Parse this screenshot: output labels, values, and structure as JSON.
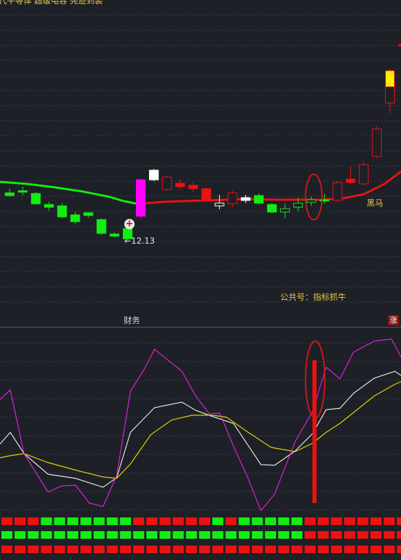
{
  "header": {
    "title": "代牛等体 超级电容 亮迹到装"
  },
  "annotations": {
    "price_low_marker": "←12.13",
    "signal_label": "黑马",
    "public_account": "公共号：指标抓牛",
    "finance_label": "财务",
    "rise_badge": "涨"
  },
  "colors": {
    "background": "#1e2027",
    "grid": "#3a3f48",
    "up": "#ee1111",
    "down": "#11ee11",
    "signal": "#ff00ff",
    "highlight_yellow": "#ffee00",
    "k_line": "#e8e8e8",
    "d_line": "#e8d800",
    "j_line": "#e020e0",
    "ellipse": "#cc1818"
  },
  "icons": {
    "plus_badge": "plus-circle-icon"
  },
  "chart_data": [
    {
      "type": "candlestick",
      "title": "",
      "candles": [
        {
          "o": 285,
          "c": 281,
          "h": 287,
          "l": 275,
          "dir": "dn",
          "col": "#11ee11"
        },
        {
          "o": 278,
          "c": 278,
          "h": 285,
          "l": 272,
          "dir": "dn",
          "col": "#11ee11"
        },
        {
          "o": 282,
          "c": 297,
          "h": 298,
          "l": 280,
          "dir": "dn",
          "col": "#11ee11"
        },
        {
          "o": 298,
          "c": 302,
          "h": 307,
          "l": 294,
          "dir": "dn",
          "col": "#11ee11"
        },
        {
          "o": 300,
          "c": 316,
          "h": 318,
          "l": 296,
          "dir": "dn",
          "col": "#11ee11"
        },
        {
          "o": 313,
          "c": 323,
          "h": 326,
          "l": 309,
          "dir": "dn",
          "col": "#11ee11"
        },
        {
          "o": 310,
          "c": 314,
          "h": 317,
          "l": 309,
          "dir": "dn",
          "col": "#11ee11"
        },
        {
          "o": 320,
          "c": 340,
          "h": 342,
          "l": 318,
          "dir": "dn",
          "col": "#11ee11"
        },
        {
          "o": 341,
          "c": 344,
          "h": 346,
          "l": 339,
          "dir": "dn",
          "col": "#11ee11"
        },
        {
          "o": 333,
          "c": 348,
          "h": 350,
          "l": 328,
          "dir": "dn",
          "col": "#11ee11"
        },
        {
          "o": 315,
          "c": 262,
          "h": 260,
          "l": 318,
          "dir": "up",
          "col": "#ff00ff"
        },
        {
          "o": 262,
          "c": 248,
          "h": 246,
          "l": 264,
          "dir": "up",
          "col": "#ffffff"
        },
        {
          "o": 276,
          "c": 258,
          "h": 256,
          "l": 278,
          "dir": "up",
          "col": "#ee1111",
          "hollow": true
        },
        {
          "o": 272,
          "c": 267,
          "h": 262,
          "l": 276,
          "dir": "up",
          "col": "#ee1111"
        },
        {
          "o": 275,
          "c": 270,
          "h": 266,
          "l": 280,
          "dir": "up",
          "col": "#ee1111"
        },
        {
          "o": 293,
          "c": 275,
          "h": 273,
          "l": 294,
          "dir": "up",
          "col": "#ee1111"
        },
        {
          "o": 296,
          "c": 300,
          "h": 284,
          "l": 305,
          "dir": "dn",
          "col": "#ffffff",
          "hollow": true
        },
        {
          "o": 297,
          "c": 281,
          "h": 278,
          "l": 302,
          "dir": "up",
          "col": "#ee1111",
          "hollow": true
        },
        {
          "o": 288,
          "c": 292,
          "h": 284,
          "l": 296,
          "dir": "dn",
          "col": "#ffffff"
        },
        {
          "o": 285,
          "c": 296,
          "h": 282,
          "l": 298,
          "dir": "dn",
          "col": "#11ee11"
        },
        {
          "o": 298,
          "c": 309,
          "h": 296,
          "l": 311,
          "dir": "dn",
          "col": "#11ee11"
        },
        {
          "o": 304,
          "c": 309,
          "h": 297,
          "l": 318,
          "dir": "dn",
          "col": "#11ee11",
          "hollow": true
        },
        {
          "o": 296,
          "c": 302,
          "h": 288,
          "l": 308,
          "dir": "dn",
          "col": "#11ee11",
          "hollow": true
        },
        {
          "o": 291,
          "c": 295,
          "h": 286,
          "l": 300,
          "dir": "dn",
          "col": "#11ee11",
          "hollow": true
        },
        {
          "o": 291,
          "c": 293,
          "h": 282,
          "l": 297,
          "dir": "dn",
          "col": "#11ee11"
        },
        {
          "o": 292,
          "c": 266,
          "h": 264,
          "l": 295,
          "dir": "up",
          "col": "#ee1111",
          "hollow": true
        },
        {
          "o": 266,
          "c": 261,
          "h": 242,
          "l": 268,
          "dir": "up",
          "col": "#ee1111"
        },
        {
          "o": 268,
          "c": 240,
          "h": 236,
          "l": 270,
          "dir": "up",
          "col": "#ee1111",
          "hollow": true
        },
        {
          "o": 228,
          "c": 188,
          "h": 183,
          "l": 230,
          "dir": "up",
          "col": "#ee1111",
          "hollow": true
        },
        {
          "o": 150,
          "c": 103,
          "h": 100,
          "l": 165,
          "dir": "up",
          "col": "#ee1111",
          "split": true
        },
        {
          "o": 65,
          "c": 65,
          "h": 10,
          "l": 65,
          "dir": "up",
          "col": "#ee1111"
        }
      ],
      "ma_line": [
        [
          0,
          265
        ],
        [
          40,
          268
        ],
        [
          80,
          273
        ],
        [
          120,
          279
        ],
        [
          160,
          287
        ],
        [
          180,
          293
        ],
        [
          200,
          297
        ],
        [
          240,
          294
        ],
        [
          300,
          292
        ],
        [
          360,
          290
        ],
        [
          400,
          291
        ],
        [
          440,
          291
        ],
        [
          470,
          291
        ],
        [
          500,
          289
        ],
        [
          530,
          283
        ],
        [
          560,
          268
        ],
        [
          584,
          250
        ]
      ],
      "ma_split_x": 205
    },
    {
      "type": "line",
      "title": "",
      "series": [
        {
          "name": "",
          "color": "#e8e8e8",
          "points": [
            [
              0,
              647
            ],
            [
              15,
              630
            ],
            [
              35,
              661
            ],
            [
              70,
              691
            ],
            [
              110,
              697
            ],
            [
              150,
              710
            ],
            [
              170,
              696
            ],
            [
              190,
              630
            ],
            [
              225,
              594
            ],
            [
              265,
              586
            ],
            [
              285,
              598
            ],
            [
              310,
              607
            ],
            [
              340,
              617
            ],
            [
              380,
              677
            ],
            [
              400,
              678
            ],
            [
              430,
              657
            ],
            [
              455,
              632
            ],
            [
              475,
              597
            ],
            [
              495,
              595
            ],
            [
              515,
              573
            ],
            [
              545,
              551
            ],
            [
              575,
              541
            ],
            [
              584,
              547
            ]
          ]
        },
        {
          "name": "",
          "color": "#e8d800",
          "points": [
            [
              0,
              667
            ],
            [
              15,
              664
            ],
            [
              35,
              661
            ],
            [
              70,
              674
            ],
            [
              110,
              685
            ],
            [
              150,
              695
            ],
            [
              170,
              697
            ],
            [
              190,
              676
            ],
            [
              220,
              633
            ],
            [
              250,
              612
            ],
            [
              280,
              605
            ],
            [
              310,
              605
            ],
            [
              330,
              608
            ],
            [
              360,
              629
            ],
            [
              395,
              652
            ],
            [
              430,
              658
            ],
            [
              455,
              646
            ],
            [
              475,
              630
            ],
            [
              495,
              617
            ],
            [
              515,
              601
            ],
            [
              545,
              577
            ],
            [
              575,
              560
            ],
            [
              584,
              556
            ]
          ]
        },
        {
          "name": "",
          "color": "#e020e0",
          "points": [
            [
              0,
              582
            ],
            [
              15,
              568
            ],
            [
              35,
              661
            ],
            [
              70,
              717
            ],
            [
              90,
              708
            ],
            [
              110,
              707
            ],
            [
              130,
              733
            ],
            [
              150,
              738
            ],
            [
              170,
              693
            ],
            [
              190,
              570
            ],
            [
              210,
              538
            ],
            [
              225,
              509
            ],
            [
              265,
              541
            ],
            [
              285,
              577
            ],
            [
              305,
              603
            ],
            [
              320,
              602
            ],
            [
              340,
              650
            ],
            [
              360,
              694
            ],
            [
              380,
              744
            ],
            [
              400,
              720
            ],
            [
              430,
              643
            ],
            [
              455,
              600
            ],
            [
              475,
              535
            ],
            [
              495,
              552
            ],
            [
              515,
              513
            ],
            [
              545,
              497
            ],
            [
              570,
              494
            ],
            [
              584,
              520
            ]
          ]
        }
      ],
      "signal_bar": {
        "x": 458,
        "top": 525,
        "bottom": 733,
        "color": "#ee1111"
      }
    },
    {
      "type": "heatmap",
      "title": "",
      "rows": [
        [
          "r",
          "r",
          "r",
          "g",
          "g",
          "g",
          "g",
          "g",
          "g",
          "g",
          "r",
          "r",
          "r",
          "r",
          "r",
          "r",
          "g",
          "r",
          "g",
          "g",
          "g",
          "g",
          "g",
          "r",
          "r",
          "r",
          "r",
          "r",
          "r",
          "r",
          "r"
        ],
        [
          "g",
          "g",
          "g",
          "g",
          "g",
          "g",
          "g",
          "g",
          "g",
          "g",
          "g",
          "g",
          "g",
          "g",
          "g",
          "g",
          "g",
          "g",
          "g",
          "g",
          "g",
          "g",
          "g",
          "r",
          "r",
          "r",
          "r",
          "r",
          "r",
          "r",
          "r"
        ],
        [
          "r",
          "r",
          "r",
          "r",
          "r",
          "r",
          "r",
          "r",
          "r",
          "r",
          "r",
          "r",
          "r",
          "r",
          "r",
          "r",
          "r",
          "r",
          "r",
          "r",
          "r",
          "r",
          "r",
          "r",
          "r",
          "r",
          "r",
          "r",
          "r",
          "r",
          "r"
        ]
      ]
    }
  ]
}
